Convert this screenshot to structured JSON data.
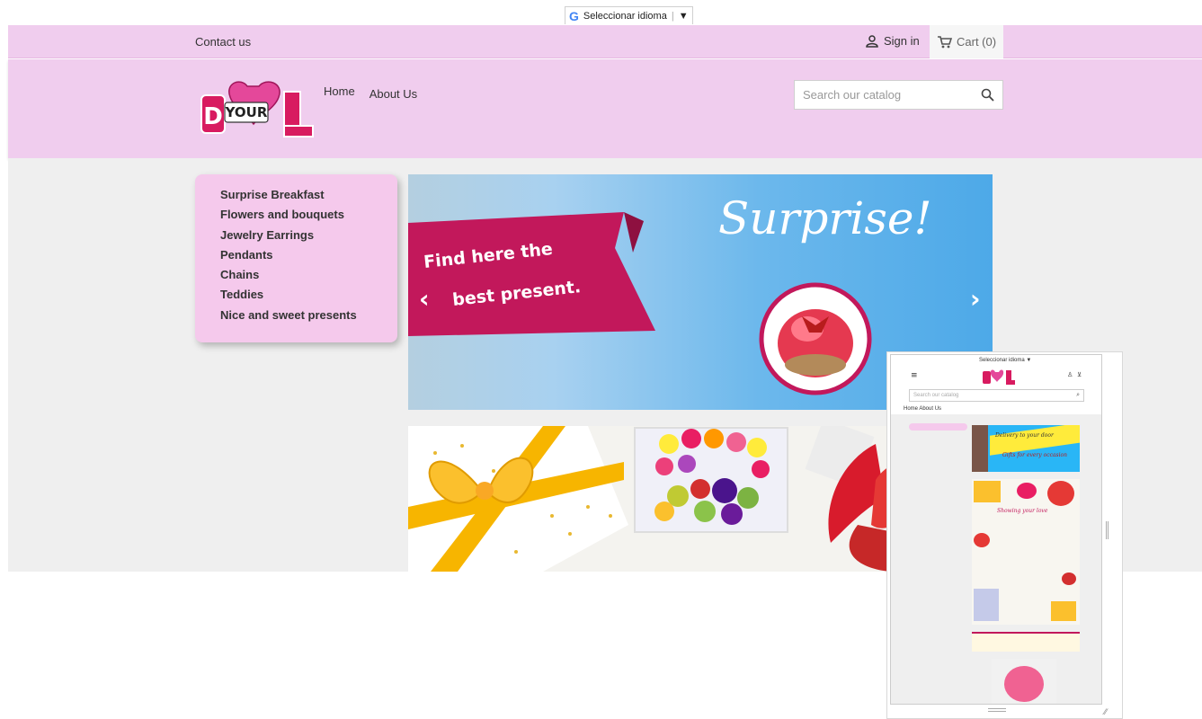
{
  "translate_bar": {
    "icon": "google-g-icon",
    "label": "Seleccionar idioma",
    "arrow": "▼"
  },
  "topnav": {
    "contact": "Contact us",
    "signin": "Sign in",
    "cart": "Cart (0)"
  },
  "header": {
    "logo_text": "YOUR DOL",
    "nav": [
      "Home",
      "About Us"
    ],
    "search_placeholder": "Search our catalog"
  },
  "categories": [
    "Surprise Breakfast",
    "Flowers and bouquets",
    "Jewelry Earrings",
    "Pendants",
    "Chains",
    "Teddies",
    "Nice and sweet presents"
  ],
  "slider": {
    "ribbon_line1": "Find here the",
    "ribbon_line2": "best present.",
    "headline": "Surprise!",
    "prev": "‹",
    "next": "›"
  },
  "preview": {
    "gt_label": "Seleccionar idioma ▼",
    "search_placeholder": "Search our catalog",
    "nav": "Home   About Us",
    "banner_line1": "Delivery to your door",
    "banner_line2": "Gifts for every occasion",
    "showcase_title": "Showing your love"
  },
  "colors": {
    "nav_bg": "#f0cdee",
    "category_bg": "#f5c9ec",
    "accent": "#c2185b",
    "sky": "#4da9e8"
  }
}
